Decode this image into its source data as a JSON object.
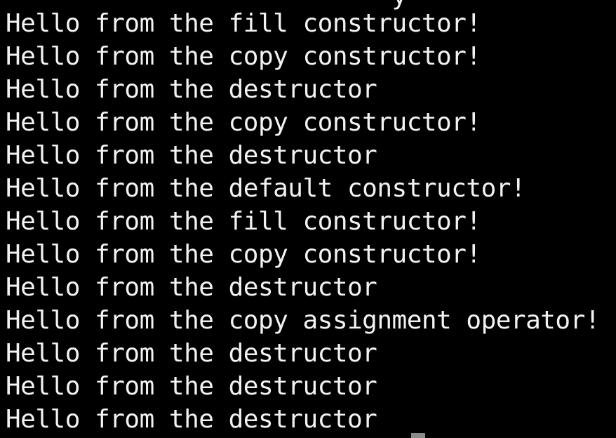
{
  "terminal": {
    "partial_top_line": "                          y",
    "lines": [
      "Hello from the fill constructor!",
      "Hello from the copy constructor!",
      "Hello from the destructor",
      "Hello from the copy constructor!",
      "Hello from the destructor",
      "Hello from the default constructor!",
      "Hello from the fill constructor!",
      "Hello from the copy constructor!",
      "Hello from the destructor",
      "Hello from the copy assignment operator!",
      "Hello from the destructor",
      "Hello from the destructor",
      "Hello from the destructor"
    ]
  },
  "colors": {
    "background": "#000000",
    "text": "#f2f2f2",
    "cursor": "#8a8a8a"
  }
}
